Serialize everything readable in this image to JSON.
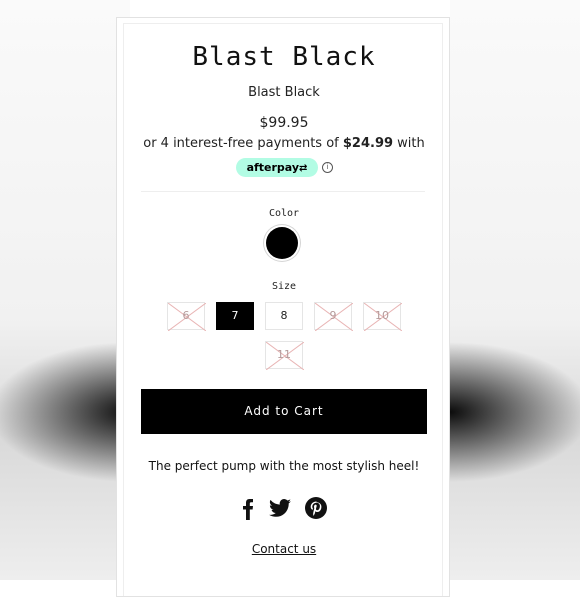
{
  "product": {
    "title": "Blast Black",
    "subtitle": "Blast Black",
    "price": "$99.95"
  },
  "afterpay": {
    "text_before": "or 4 interest-free payments of ",
    "amount": "$24.99",
    "text_after": " with",
    "badge_label": "afterpay",
    "info_icon": "ⓘ"
  },
  "color": {
    "label": "Color",
    "selected_swatch_color": "#000000"
  },
  "size": {
    "label": "Size",
    "options": [
      {
        "label": "6",
        "state": "sold-out"
      },
      {
        "label": "7",
        "state": "selected"
      },
      {
        "label": "8",
        "state": "available"
      },
      {
        "label": "9",
        "state": "sold-out"
      },
      {
        "label": "10",
        "state": "sold-out"
      },
      {
        "label": "11",
        "state": "sold-out"
      }
    ]
  },
  "cart": {
    "button_label": "Add to Cart"
  },
  "description": "The perfect pump with the most stylish heel!",
  "social": {
    "icons": [
      "facebook-icon",
      "twitter-icon",
      "pinterest-icon"
    ]
  },
  "contact": {
    "link_label": "Contact us"
  },
  "colors": {
    "accent": "#000000",
    "afterpay_mint": "#b2fce4",
    "sold_out_strike": "#e8b4b4"
  }
}
